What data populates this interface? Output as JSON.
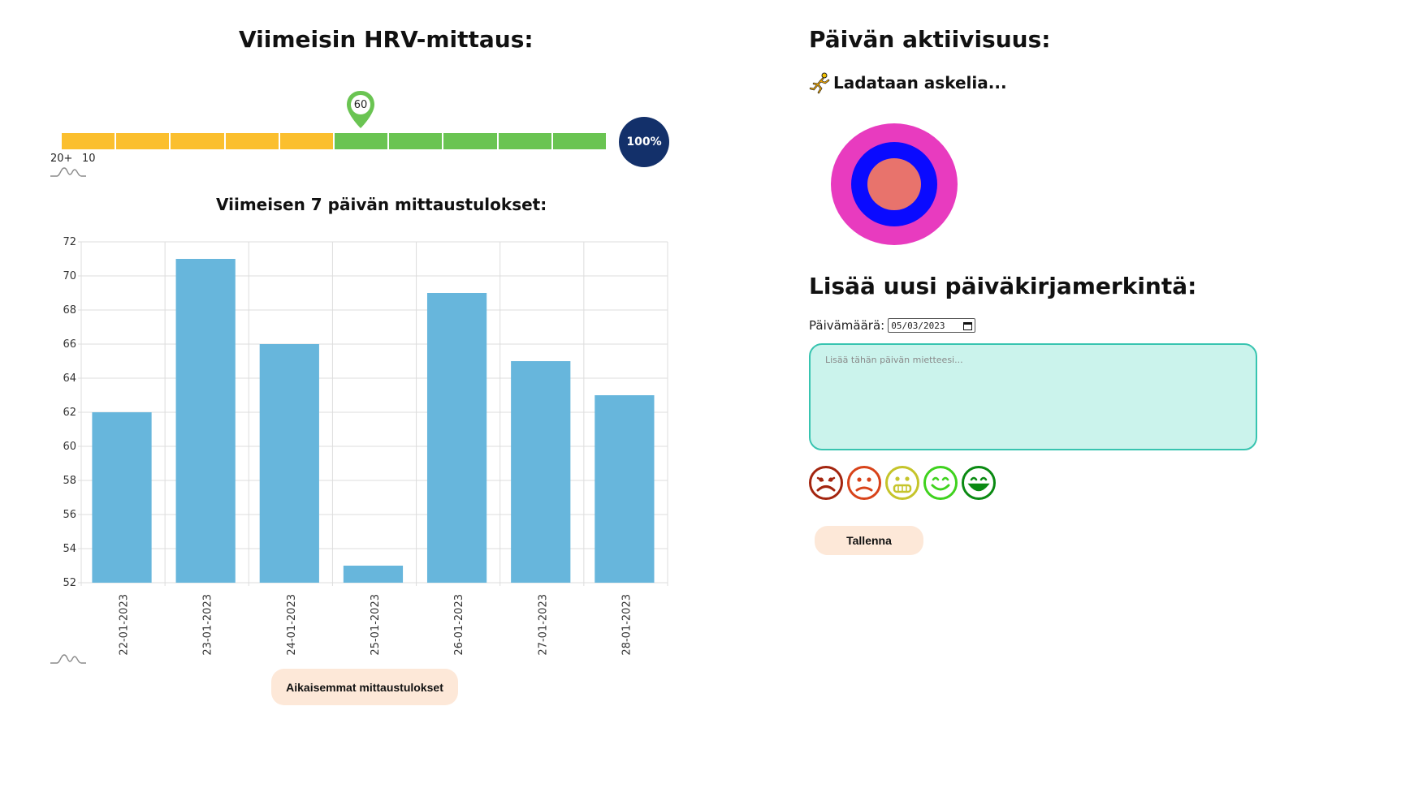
{
  "hrv": {
    "title": "Viimeisin HRV-mittaus:",
    "marker_value": "60",
    "percent": "100%",
    "scale_labels": [
      "20+",
      "10"
    ],
    "segments_yellow": 5,
    "segments_green": 5
  },
  "weekly": {
    "title": "Viimeisen 7 päivän mittaustulokset:"
  },
  "chart_data": {
    "type": "bar",
    "categories": [
      "22-01-2023",
      "23-01-2023",
      "24-01-2023",
      "25-01-2023",
      "26-01-2023",
      "27-01-2023",
      "28-01-2023"
    ],
    "values": [
      62,
      71,
      66,
      53,
      69,
      65,
      63
    ],
    "ylim": [
      52,
      72
    ],
    "yticks": [
      52,
      54,
      56,
      58,
      60,
      62,
      64,
      66,
      68,
      70,
      72
    ],
    "grid": true,
    "bar_color": "#67b6dc"
  },
  "history_button": "Aikaisemmat mittaustulokset",
  "activity": {
    "title": "Päivän aktiivisuus:",
    "loading_text": "Ladataan askelia...",
    "ring_colors": [
      "#e83bbf",
      "#0a0aff",
      "#e8736c"
    ]
  },
  "diary": {
    "title": "Lisää uusi päiväkirjamerkintä:",
    "date_label": "Päivämäärä:",
    "date_value": "05/03/2023",
    "placeholder": "Lisää tähän päivän mietteesi...",
    "save_label": "Tallenna",
    "moods": [
      {
        "name": "very-sad",
        "color": "#a3250f"
      },
      {
        "name": "sad",
        "color": "#d8431a"
      },
      {
        "name": "neutral",
        "color": "#c5c42a"
      },
      {
        "name": "happy",
        "color": "#3fd21e"
      },
      {
        "name": "very-happy",
        "color": "#0a8a12"
      }
    ]
  }
}
